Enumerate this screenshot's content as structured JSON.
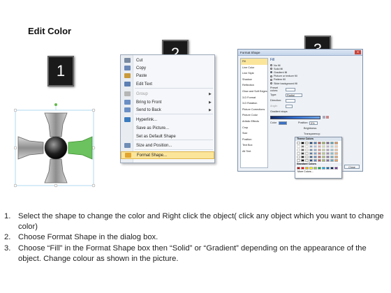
{
  "page": {
    "title": "Edit Color"
  },
  "badges": [
    "1",
    "2",
    "3"
  ],
  "context_menu": {
    "items": [
      {
        "label": "Cut",
        "underline": "t",
        "icon": "scissors-icon",
        "icon_color": "#7a8aa0",
        "disabled": false,
        "submenu": false
      },
      {
        "label": "Copy",
        "icon": "copy-icon",
        "icon_color": "#6a87b6",
        "disabled": false,
        "submenu": false
      },
      {
        "label": "Paste",
        "icon": "paste-icon",
        "icon_color": "#c99a3b",
        "disabled": false,
        "submenu": false
      },
      {
        "label": "Edit Text",
        "icon": "edit-text-icon",
        "icon_color": "#5d7fb3",
        "disabled": false,
        "submenu": false
      },
      {
        "label": "Group",
        "icon": "group-icon",
        "icon_color": "#b6b6b6",
        "disabled": true,
        "submenu": true
      },
      {
        "label": "Bring to Front",
        "icon": "bring-front-icon",
        "icon_color": "#6b8fc4",
        "disabled": false,
        "submenu": true
      },
      {
        "label": "Send to Back",
        "icon": "send-back-icon",
        "icon_color": "#6b8fc4",
        "disabled": false,
        "submenu": true
      },
      {
        "label": "Hyperlink...",
        "icon": "hyperlink-icon",
        "icon_color": "#3d7bbf",
        "disabled": false,
        "submenu": false
      },
      {
        "label": "Save as Picture...",
        "icon": "",
        "icon_color": "",
        "disabled": false,
        "submenu": false
      },
      {
        "label": "Set as Default Shape",
        "icon": "",
        "icon_color": "",
        "disabled": false,
        "submenu": false
      },
      {
        "label": "Size and Position...",
        "icon": "size-position-icon",
        "icon_color": "#6f8db5",
        "disabled": false,
        "submenu": false
      },
      {
        "label": "Format Shape...",
        "icon": "format-shape-icon",
        "icon_color": "#e2a530",
        "disabled": false,
        "submenu": false,
        "highlighted": true
      }
    ]
  },
  "dialog": {
    "title": "Format Shape",
    "nav": [
      "Fill",
      "Line Color",
      "Line Style",
      "Shadow",
      "Reflection",
      "Glow and Soft Edges",
      "3-D Format",
      "3-D Rotation",
      "Picture Corrections",
      "Picture Color",
      "Artistic Effects",
      "Crop",
      "Size",
      "Position",
      "Text Box",
      "Alt Text"
    ],
    "fill_heading": "Fill",
    "options": [
      "No fill",
      "Solid fill",
      "Gradient fill",
      "Picture or texture fill",
      "Pattern fill",
      "Slide background fill"
    ],
    "selected_option": 2,
    "fields": {
      "preset_label": "Preset colors:",
      "type_label": "Type:",
      "type_value": "Radial",
      "direction_label": "Direction:",
      "angle_label": "Angle:",
      "stops_label": "Gradient stops",
      "color_label": "Color",
      "position_label": "Position:",
      "position_value": "0%",
      "brightness_label": "Brightness:",
      "transparency_label": "Transparency:",
      "rotate_label": "Rotate with shape"
    },
    "close_label": "Close",
    "palette": {
      "theme_label": "Theme Colors",
      "standard_label": "Standard Colors",
      "more_label": "More Colors..."
    }
  },
  "instructions": [
    {
      "num": "1.",
      "text": "Select the shape to change the color and Right click the object( click any object which you want to change color)"
    },
    {
      "num": "2.",
      "text": "Choose Format Shape in the dialog box."
    },
    {
      "num": "3.",
      "text": "Choose “Fill” in the Format Shape box then “Solid” or “Gradient” depending on the appearance of the object. Change colour as shown in the picture."
    }
  ]
}
